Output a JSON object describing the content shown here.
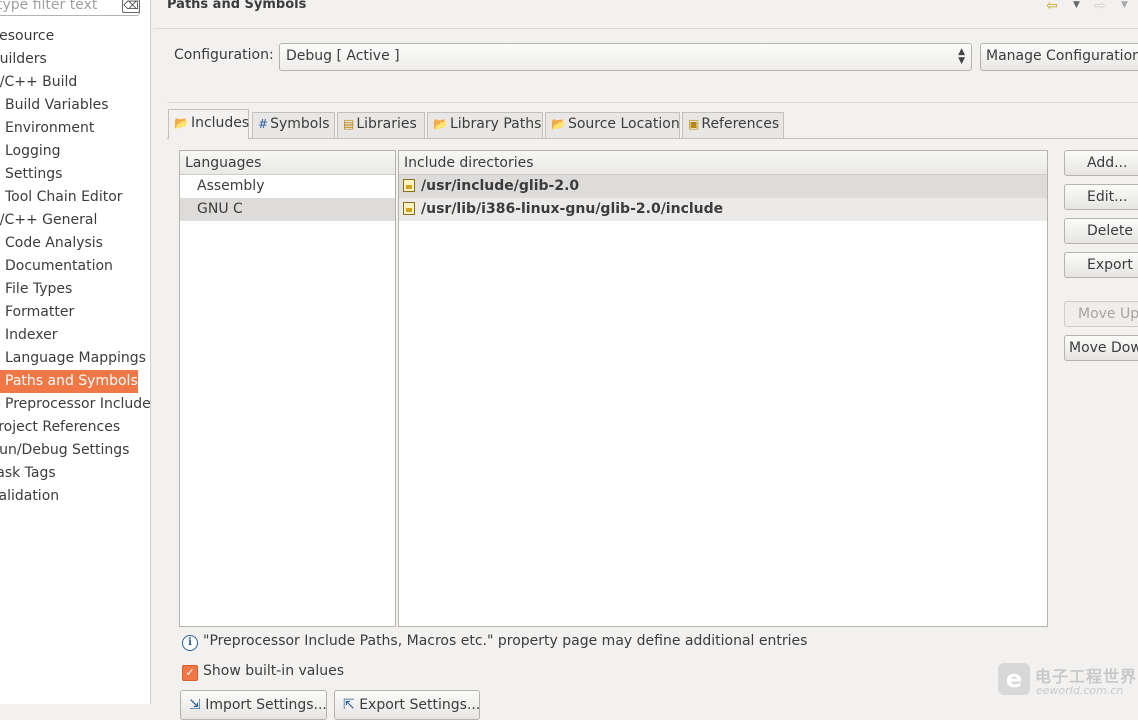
{
  "filter": {
    "placeholder": "type filter text",
    "clear_icon": "⌫"
  },
  "tree": [
    {
      "label": "Resource",
      "level": 0
    },
    {
      "label": "Builders",
      "level": 0
    },
    {
      "label": "C/C++ Build",
      "level": 0
    },
    {
      "label": "Build Variables",
      "level": 1
    },
    {
      "label": "Environment",
      "level": 1
    },
    {
      "label": "Logging",
      "level": 1
    },
    {
      "label": "Settings",
      "level": 1
    },
    {
      "label": "Tool Chain Editor",
      "level": 1
    },
    {
      "label": "C/C++ General",
      "level": 0
    },
    {
      "label": "Code Analysis",
      "level": 1
    },
    {
      "label": "Documentation",
      "level": 1
    },
    {
      "label": "File Types",
      "level": 1
    },
    {
      "label": "Formatter",
      "level": 1
    },
    {
      "label": "Indexer",
      "level": 1
    },
    {
      "label": "Language Mappings",
      "level": 1
    },
    {
      "label": "Paths and Symbols",
      "level": 1,
      "selected": true
    },
    {
      "label": "Preprocessor Include Paths",
      "level": 1
    },
    {
      "label": "Project References",
      "level": 0
    },
    {
      "label": "Run/Debug Settings",
      "level": 0
    },
    {
      "label": "Task Tags",
      "level": 0
    },
    {
      "label": "Validation",
      "level": 0
    }
  ],
  "header": {
    "title": "Paths and Symbols",
    "back_icon": "⇦",
    "forward_icon": "⇨",
    "dropdown_icon": "▼"
  },
  "configuration": {
    "label": "Configuration:",
    "selected": "Debug  [ Active ]",
    "manage_label": "Manage Configurations..."
  },
  "tabs": [
    {
      "label": "Includes",
      "icon": "📂",
      "active": true
    },
    {
      "label": "Symbols",
      "icon": "#"
    },
    {
      "label": "Libraries",
      "icon": "▤"
    },
    {
      "label": "Library Paths",
      "icon": "📂"
    },
    {
      "label": "Source Location",
      "icon": "📂"
    },
    {
      "label": "References",
      "icon": "▣"
    }
  ],
  "languages": {
    "header": "Languages",
    "items": [
      {
        "label": "Assembly"
      },
      {
        "label": "GNU C",
        "selected": true
      }
    ]
  },
  "include_dirs": {
    "header": "Include directories",
    "items": [
      "/usr/include/glib-2.0",
      "/usr/lib/i386-linux-gnu/glib-2.0/include"
    ]
  },
  "side_buttons": [
    {
      "label": "Add...",
      "enabled": true
    },
    {
      "label": "Edit...",
      "enabled": true
    },
    {
      "label": "Delete",
      "enabled": true
    },
    {
      "label": "Export",
      "enabled": true
    },
    {
      "label": "Move Up",
      "enabled": false
    },
    {
      "label": "Move Down",
      "enabled": true
    }
  ],
  "info_text": "\"Preprocessor Include Paths, Macros etc.\" property page may define additional entries",
  "show_builtin": {
    "label": "Show built-in values",
    "checked": true
  },
  "bottom_buttons": [
    {
      "label": "Import Settings..."
    },
    {
      "label": "Export Settings..."
    }
  ],
  "watermark": {
    "cn": "电子工程世界",
    "url": "eeworld.com.cn",
    "logo_letter": "e"
  },
  "colors": {
    "accent": "#f07746",
    "selection_gray": "#dedcda"
  }
}
